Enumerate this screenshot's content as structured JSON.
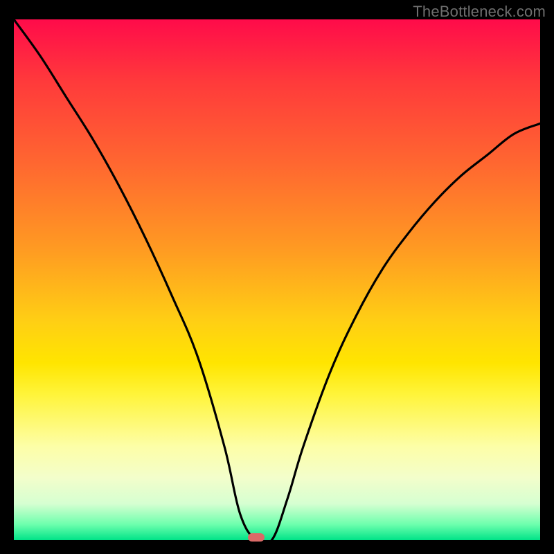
{
  "watermark": "TheBottleneck.com",
  "colors": {
    "border": "#000000",
    "gradient_top": "#ff0b4a",
    "gradient_bottom": "#00e388",
    "curve": "#000000",
    "marker": "#da6a67"
  },
  "chart_data": {
    "type": "line",
    "title": "",
    "xlabel": "",
    "ylabel": "",
    "x_range": [
      0,
      100
    ],
    "y_range": [
      0,
      100
    ],
    "grid": false,
    "annotations": [
      {
        "text": "TheBottleneck.com",
        "position": "top-right"
      }
    ],
    "marker": {
      "x": 46,
      "y": 0,
      "color": "#da6a67"
    },
    "series": [
      {
        "name": "bottleneck_curve",
        "color": "#000000",
        "x": [
          0,
          5,
          10,
          15,
          20,
          25,
          30,
          35,
          40,
          43,
          46,
          49,
          52,
          55,
          60,
          65,
          70,
          75,
          80,
          85,
          90,
          95,
          100
        ],
        "y": [
          100,
          93,
          85,
          77,
          68,
          58,
          47,
          35,
          18,
          5,
          0,
          0,
          8,
          18,
          32,
          43,
          52,
          59,
          65,
          70,
          74,
          78,
          80
        ]
      }
    ],
    "background_gradient": {
      "direction": "top_to_bottom",
      "stops": [
        {
          "pos": 0.0,
          "color": "#ff0b4a"
        },
        {
          "pos": 0.12,
          "color": "#ff3a3b"
        },
        {
          "pos": 0.28,
          "color": "#ff6830"
        },
        {
          "pos": 0.44,
          "color": "#ff9a22"
        },
        {
          "pos": 0.58,
          "color": "#ffcf14"
        },
        {
          "pos": 0.66,
          "color": "#ffe500"
        },
        {
          "pos": 0.72,
          "color": "#fff43a"
        },
        {
          "pos": 0.82,
          "color": "#fdfea7"
        },
        {
          "pos": 0.88,
          "color": "#f3fecb"
        },
        {
          "pos": 0.93,
          "color": "#d6ffd1"
        },
        {
          "pos": 0.97,
          "color": "#6dffad"
        },
        {
          "pos": 1.0,
          "color": "#00e388"
        }
      ]
    }
  }
}
